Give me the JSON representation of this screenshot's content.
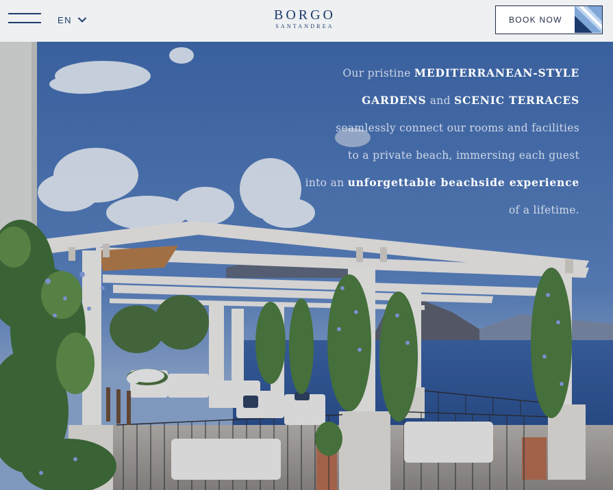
{
  "header": {
    "menu_icon": "hamburger-menu-icon",
    "language": "EN",
    "language_icon": "chevron-down-icon",
    "logo_main": "BORGO",
    "logo_sub": "SANTANDREA",
    "book_now": "BOOK NOW",
    "book_icon": "diagonal-stripe-graphic"
  },
  "hero": {
    "line1_a": "Our pristine ",
    "line1_b": "MEDITERRANEAN-STYLE",
    "line2_a": "GARDENS",
    "line2_b": " and ",
    "line2_c": "SCENIC TERRACES",
    "line3": "seamlessly connect our rooms and facilities",
    "line4": "to a private beach, immersing each guest",
    "line5_a": "into an ",
    "line5_b": "unforgettable beachside experience",
    "line6": "of a lifetime."
  },
  "colors": {
    "brand_navy": "#1c3a6b",
    "header_bg": "#eef0f2",
    "sky": "#4f76b3",
    "sea": "#2c4f8e"
  }
}
